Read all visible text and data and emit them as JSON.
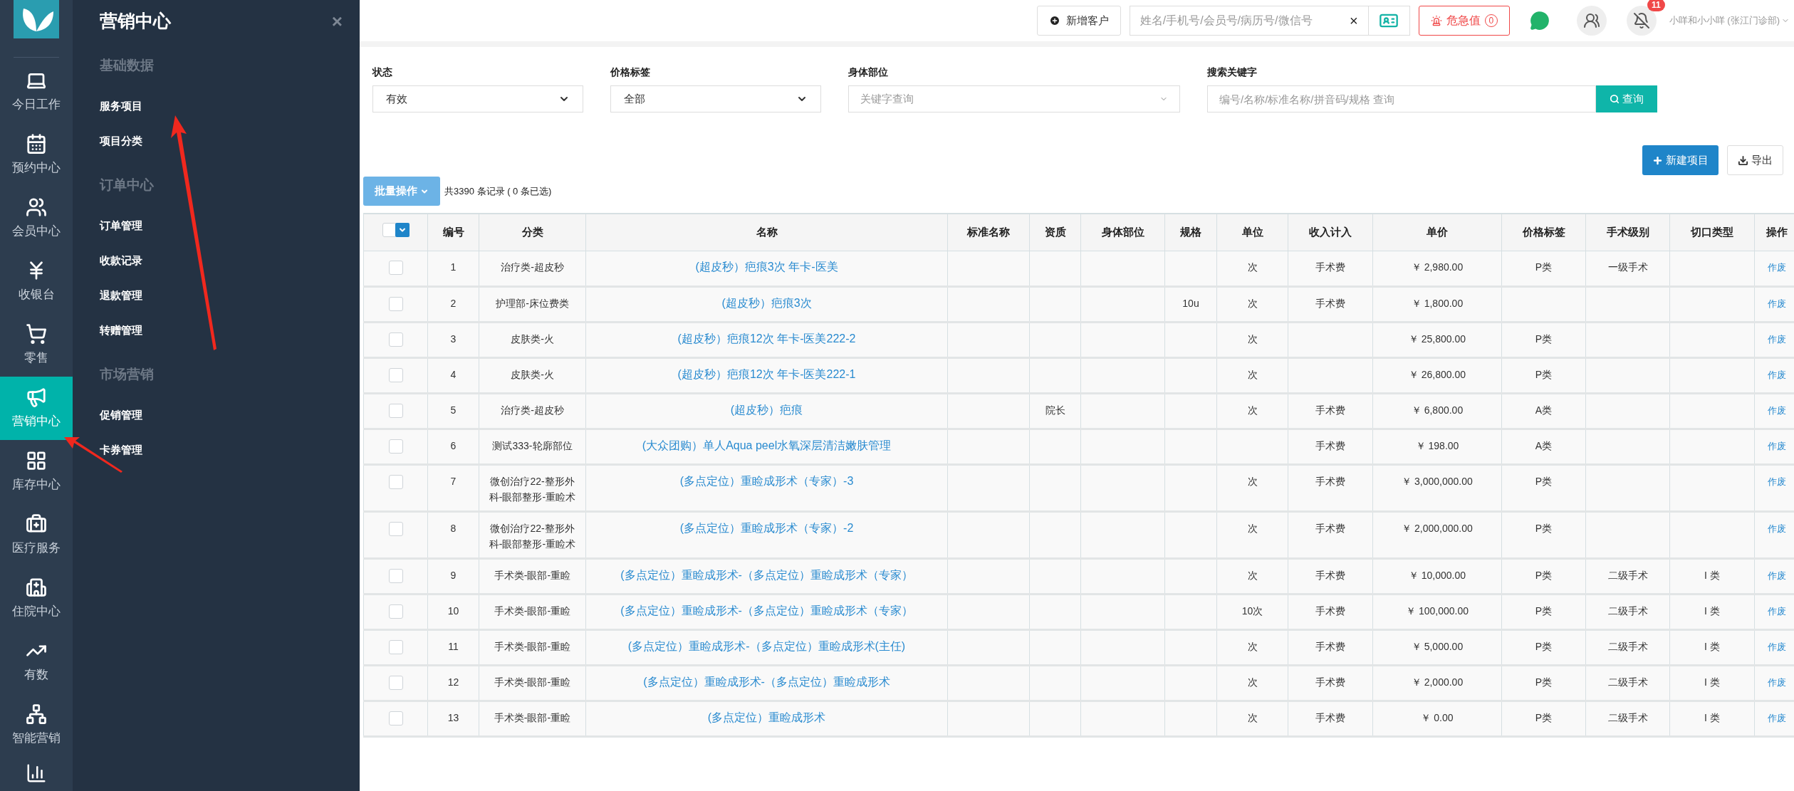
{
  "rail": [
    {
      "label": "今日工作",
      "selected": false
    },
    {
      "label": "预约中心",
      "selected": false
    },
    {
      "label": "会员中心",
      "selected": false
    },
    {
      "label": "收银台",
      "selected": false
    },
    {
      "label": "零售",
      "selected": false
    },
    {
      "label": "营销中心",
      "selected": true
    },
    {
      "label": "库存中心",
      "selected": false
    },
    {
      "label": "医疗服务",
      "selected": false
    },
    {
      "label": "住院中心",
      "selected": false
    },
    {
      "label": "有数",
      "selected": false
    },
    {
      "label": "智能营销",
      "selected": false
    }
  ],
  "submenu": {
    "title": "营销中心",
    "close": "×",
    "groups": [
      {
        "heading": "基础数据",
        "items": [
          "服务项目",
          "项目分类"
        ]
      },
      {
        "heading": "订单中心",
        "items": [
          "订单管理",
          "收款记录",
          "退款管理",
          "转赠管理"
        ]
      },
      {
        "heading": "市场营销",
        "items": [
          "促销管理",
          "卡券管理"
        ]
      }
    ]
  },
  "topbar": {
    "new_customer": "新增客户",
    "search": {
      "placeholder": "姓名/手机号/会员号/病历号/微信号",
      "clear": "×"
    },
    "critical": {
      "label": "危急值",
      "count": "0"
    },
    "notifications": "11",
    "user": "小咩和小小咩 (张江门诊部)"
  },
  "filters": [
    {
      "kind": "select",
      "label": "状态",
      "value": "有效"
    },
    {
      "kind": "select",
      "label": "价格标签",
      "value": "全部"
    },
    {
      "kind": "combo",
      "label": "身体部位",
      "placeholder": "关键字查询"
    },
    {
      "kind": "search",
      "label": "搜索关键字",
      "placeholder": "编号/名称/标准名称/拼音码/规格 查询",
      "button": "查询"
    }
  ],
  "actions": {
    "create": "新建项目",
    "export": "导出",
    "batch": "批量操作",
    "summary": "共3390 条记录 ( 0 条已选)"
  },
  "table": {
    "columns": [
      "编号",
      "分类",
      "名称",
      "标准名称",
      "资质",
      "身体部位",
      "规格",
      "单位",
      "收入计入",
      "单价",
      "价格标签",
      "手术级别",
      "切口类型",
      "操作"
    ],
    "header_checked": false,
    "rows": [
      {
        "checked": false,
        "cells": [
          "1",
          "治疗类-超皮秒",
          "(超皮秒）疤痕3次 年卡-医美",
          "",
          "",
          "",
          "",
          "次",
          "手术费",
          "￥ 2,980.00",
          "P类",
          "一级手术",
          "",
          "作废"
        ]
      },
      {
        "checked": false,
        "cells": [
          "2",
          "护理部-床位费类",
          "(超皮秒）疤痕3次",
          "",
          "",
          "",
          "10u",
          "次",
          "手术费",
          "￥ 1,800.00",
          "",
          "",
          "",
          "作废"
        ]
      },
      {
        "checked": false,
        "cells": [
          "3",
          "皮肤类-火",
          "(超皮秒）疤痕12次 年卡-医美222-2",
          "",
          "",
          "",
          "",
          "次",
          "",
          "￥ 25,800.00",
          "P类",
          "",
          "",
          "作废"
        ]
      },
      {
        "checked": false,
        "cells": [
          "4",
          "皮肤类-火",
          "(超皮秒）疤痕12次 年卡-医美222-1",
          "",
          "",
          "",
          "",
          "次",
          "",
          "￥ 26,800.00",
          "P类",
          "",
          "",
          "作废"
        ]
      },
      {
        "checked": false,
        "cells": [
          "5",
          "治疗类-超皮秒",
          "(超皮秒）疤痕",
          "",
          "院长",
          "",
          "",
          "次",
          "手术费",
          "￥ 6,800.00",
          "A类",
          "",
          "",
          "作废"
        ]
      },
      {
        "checked": false,
        "cells": [
          "6",
          "测试333-轮廓部位",
          "(大众团购）单人Aqua peel水氧深层清洁嫩肤管理",
          "",
          "",
          "",
          "",
          "",
          "手术费",
          "￥ 198.00",
          "A类",
          "",
          "",
          "作废"
        ]
      },
      {
        "checked": false,
        "cells": [
          "7",
          "微创治疗22-整形外科-眼部整形-重睑术",
          "(多点定位）重睑成形术（专家）-3",
          "",
          "",
          "",
          "",
          "次",
          "手术费",
          "￥ 3,000,000.00",
          "P类",
          "",
          "",
          "作废"
        ]
      },
      {
        "checked": false,
        "cells": [
          "8",
          "微创治疗22-整形外科-眼部整形-重睑术",
          "(多点定位）重睑成形术（专家）-2",
          "",
          "",
          "",
          "",
          "次",
          "手术费",
          "￥ 2,000,000.00",
          "P类",
          "",
          "",
          "作废"
        ]
      },
      {
        "checked": false,
        "cells": [
          "9",
          "手术类-眼部-重睑",
          "(多点定位）重睑成形术-（多点定位）重睑成形术（专家）",
          "",
          "",
          "",
          "",
          "次",
          "手术费",
          "￥ 10,000.00",
          "P类",
          "二级手术",
          "I 类",
          "作废"
        ]
      },
      {
        "checked": false,
        "cells": [
          "10",
          "手术类-眼部-重睑",
          "(多点定位）重睑成形术-（多点定位）重睑成形术（专家）",
          "",
          "",
          "",
          "",
          "10次",
          "手术费",
          "￥ 100,000.00",
          "P类",
          "二级手术",
          "I 类",
          "作废"
        ]
      },
      {
        "checked": false,
        "cells": [
          "11",
          "手术类-眼部-重睑",
          "(多点定位）重睑成形术-（多点定位）重睑成形术(主任)",
          "",
          "",
          "",
          "",
          "次",
          "手术费",
          "￥ 5,000.00",
          "P类",
          "二级手术",
          "I 类",
          "作废"
        ]
      },
      {
        "checked": false,
        "cells": [
          "12",
          "手术类-眼部-重睑",
          "(多点定位）重睑成形术-（多点定位）重睑成形术",
          "",
          "",
          "",
          "",
          "次",
          "手术费",
          "￥ 2,000.00",
          "P类",
          "二级手术",
          "I 类",
          "作废"
        ]
      },
      {
        "checked": false,
        "cells": [
          "13",
          "手术类-眼部-重睑",
          "(多点定位）重睑成形术",
          "",
          "",
          "",
          "",
          "次",
          "手术费",
          "￥ 0.00",
          "P类",
          "二级手术",
          "I 类",
          "作废"
        ]
      }
    ]
  }
}
